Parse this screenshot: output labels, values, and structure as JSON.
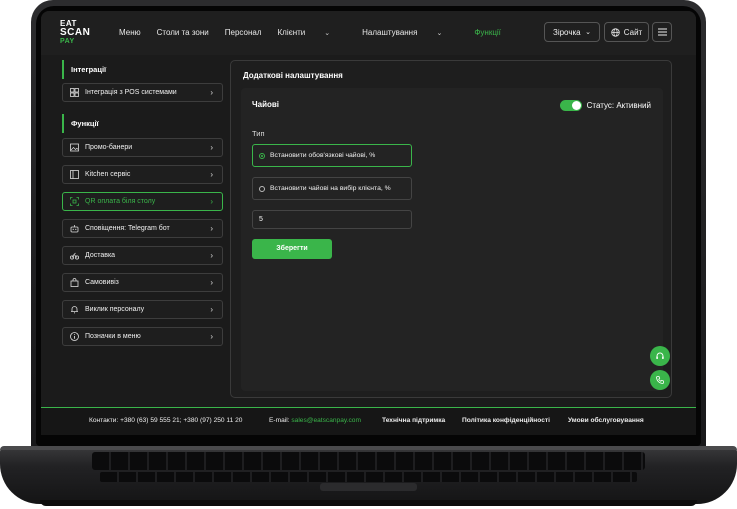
{
  "colors": {
    "accent": "#3ab54a",
    "background": "#1b1b1b"
  },
  "logo": {
    "line1": "EAT",
    "line2": "SCAN",
    "line3": "PAY"
  },
  "nav": {
    "menu": "Меню",
    "tables": "Столи та зони",
    "staff": "Персонал",
    "clients": "Клієнти",
    "settings": "Налаштування",
    "functions": "Функції"
  },
  "header": {
    "place": "Зірочка",
    "site": "Сайт"
  },
  "sidebar": {
    "integrations_title": "Інтеграції",
    "integrations": [
      {
        "label": "Інтеграція з POS системами",
        "icon": "pos-icon"
      }
    ],
    "functions_title": "Функції",
    "functions": [
      {
        "label": "Промо-банери",
        "icon": "image-icon"
      },
      {
        "label": "Kitchen сервіс",
        "icon": "kitchen-icon"
      },
      {
        "label": "QR оплата біля столу",
        "icon": "qr-icon"
      },
      {
        "label": "Сповіщення: Telegram бот",
        "icon": "bot-icon"
      },
      {
        "label": "Доставка",
        "icon": "bike-icon"
      },
      {
        "label": "Самовивіз",
        "icon": "bag-icon"
      },
      {
        "label": "Виклик персоналу",
        "icon": "bell-icon"
      },
      {
        "label": "Позначки в меню",
        "icon": "info-icon"
      }
    ]
  },
  "main": {
    "title": "Додаткові налаштування",
    "card_title": "Чайові",
    "status_label": "Статус: Активний",
    "type_label": "Тип",
    "option_required": "Встановити обов'язкові чайові, %",
    "option_client": "Встановити чайові на вибір клієнта, %",
    "value": "5",
    "save": "Зберегти"
  },
  "footer": {
    "contacts": "Контакти: +380 (63) 59 555 21; +380 (97) 250 11 20",
    "email_label": "E-mail:",
    "email": "sales@eatscanpay.com",
    "support": "Технічна підтримка",
    "privacy": "Політика конфіденційності",
    "terms": "Умови обслуговування"
  }
}
